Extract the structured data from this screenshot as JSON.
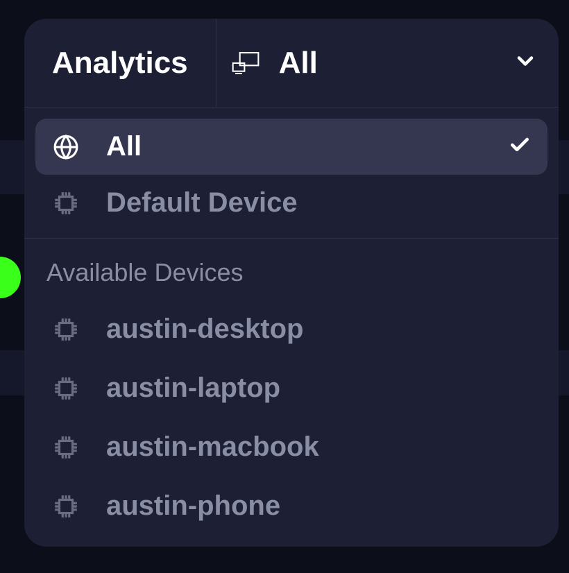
{
  "header": {
    "tab_label": "Analytics",
    "selector_label": "All"
  },
  "options": {
    "all": {
      "label": "All",
      "selected": true
    },
    "default": {
      "label": "Default Device",
      "selected": false
    }
  },
  "section_header": "Available Devices",
  "devices": [
    {
      "label": "austin-desktop"
    },
    {
      "label": "austin-laptop"
    },
    {
      "label": "austin-macbook"
    },
    {
      "label": "austin-phone"
    }
  ]
}
